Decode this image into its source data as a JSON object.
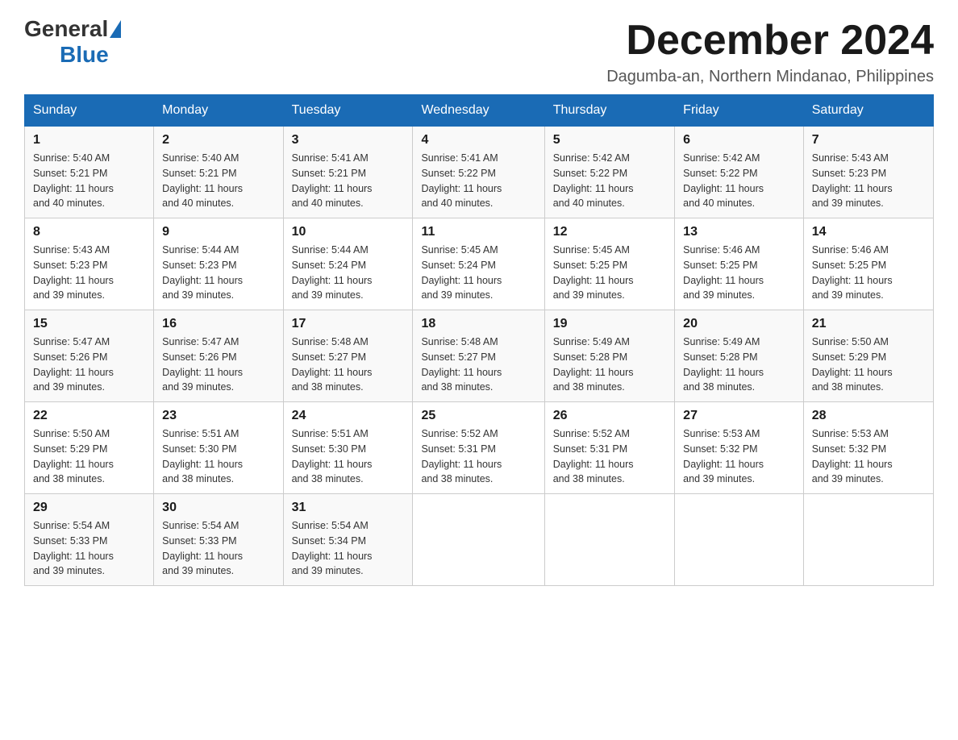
{
  "logo": {
    "general": "General",
    "blue": "Blue"
  },
  "header": {
    "month": "December 2024",
    "location": "Dagumba-an, Northern Mindanao, Philippines"
  },
  "days_of_week": [
    "Sunday",
    "Monday",
    "Tuesday",
    "Wednesday",
    "Thursday",
    "Friday",
    "Saturday"
  ],
  "weeks": [
    [
      {
        "day": "1",
        "sunrise": "5:40 AM",
        "sunset": "5:21 PM",
        "daylight": "11 hours and 40 minutes."
      },
      {
        "day": "2",
        "sunrise": "5:40 AM",
        "sunset": "5:21 PM",
        "daylight": "11 hours and 40 minutes."
      },
      {
        "day": "3",
        "sunrise": "5:41 AM",
        "sunset": "5:21 PM",
        "daylight": "11 hours and 40 minutes."
      },
      {
        "day": "4",
        "sunrise": "5:41 AM",
        "sunset": "5:22 PM",
        "daylight": "11 hours and 40 minutes."
      },
      {
        "day": "5",
        "sunrise": "5:42 AM",
        "sunset": "5:22 PM",
        "daylight": "11 hours and 40 minutes."
      },
      {
        "day": "6",
        "sunrise": "5:42 AM",
        "sunset": "5:22 PM",
        "daylight": "11 hours and 40 minutes."
      },
      {
        "day": "7",
        "sunrise": "5:43 AM",
        "sunset": "5:23 PM",
        "daylight": "11 hours and 39 minutes."
      }
    ],
    [
      {
        "day": "8",
        "sunrise": "5:43 AM",
        "sunset": "5:23 PM",
        "daylight": "11 hours and 39 minutes."
      },
      {
        "day": "9",
        "sunrise": "5:44 AM",
        "sunset": "5:23 PM",
        "daylight": "11 hours and 39 minutes."
      },
      {
        "day": "10",
        "sunrise": "5:44 AM",
        "sunset": "5:24 PM",
        "daylight": "11 hours and 39 minutes."
      },
      {
        "day": "11",
        "sunrise": "5:45 AM",
        "sunset": "5:24 PM",
        "daylight": "11 hours and 39 minutes."
      },
      {
        "day": "12",
        "sunrise": "5:45 AM",
        "sunset": "5:25 PM",
        "daylight": "11 hours and 39 minutes."
      },
      {
        "day": "13",
        "sunrise": "5:46 AM",
        "sunset": "5:25 PM",
        "daylight": "11 hours and 39 minutes."
      },
      {
        "day": "14",
        "sunrise": "5:46 AM",
        "sunset": "5:25 PM",
        "daylight": "11 hours and 39 minutes."
      }
    ],
    [
      {
        "day": "15",
        "sunrise": "5:47 AM",
        "sunset": "5:26 PM",
        "daylight": "11 hours and 39 minutes."
      },
      {
        "day": "16",
        "sunrise": "5:47 AM",
        "sunset": "5:26 PM",
        "daylight": "11 hours and 39 minutes."
      },
      {
        "day": "17",
        "sunrise": "5:48 AM",
        "sunset": "5:27 PM",
        "daylight": "11 hours and 38 minutes."
      },
      {
        "day": "18",
        "sunrise": "5:48 AM",
        "sunset": "5:27 PM",
        "daylight": "11 hours and 38 minutes."
      },
      {
        "day": "19",
        "sunrise": "5:49 AM",
        "sunset": "5:28 PM",
        "daylight": "11 hours and 38 minutes."
      },
      {
        "day": "20",
        "sunrise": "5:49 AM",
        "sunset": "5:28 PM",
        "daylight": "11 hours and 38 minutes."
      },
      {
        "day": "21",
        "sunrise": "5:50 AM",
        "sunset": "5:29 PM",
        "daylight": "11 hours and 38 minutes."
      }
    ],
    [
      {
        "day": "22",
        "sunrise": "5:50 AM",
        "sunset": "5:29 PM",
        "daylight": "11 hours and 38 minutes."
      },
      {
        "day": "23",
        "sunrise": "5:51 AM",
        "sunset": "5:30 PM",
        "daylight": "11 hours and 38 minutes."
      },
      {
        "day": "24",
        "sunrise": "5:51 AM",
        "sunset": "5:30 PM",
        "daylight": "11 hours and 38 minutes."
      },
      {
        "day": "25",
        "sunrise": "5:52 AM",
        "sunset": "5:31 PM",
        "daylight": "11 hours and 38 minutes."
      },
      {
        "day": "26",
        "sunrise": "5:52 AM",
        "sunset": "5:31 PM",
        "daylight": "11 hours and 38 minutes."
      },
      {
        "day": "27",
        "sunrise": "5:53 AM",
        "sunset": "5:32 PM",
        "daylight": "11 hours and 39 minutes."
      },
      {
        "day": "28",
        "sunrise": "5:53 AM",
        "sunset": "5:32 PM",
        "daylight": "11 hours and 39 minutes."
      }
    ],
    [
      {
        "day": "29",
        "sunrise": "5:54 AM",
        "sunset": "5:33 PM",
        "daylight": "11 hours and 39 minutes."
      },
      {
        "day": "30",
        "sunrise": "5:54 AM",
        "sunset": "5:33 PM",
        "daylight": "11 hours and 39 minutes."
      },
      {
        "day": "31",
        "sunrise": "5:54 AM",
        "sunset": "5:34 PM",
        "daylight": "11 hours and 39 minutes."
      },
      null,
      null,
      null,
      null
    ]
  ],
  "labels": {
    "sunrise": "Sunrise:",
    "sunset": "Sunset:",
    "daylight": "Daylight:"
  }
}
